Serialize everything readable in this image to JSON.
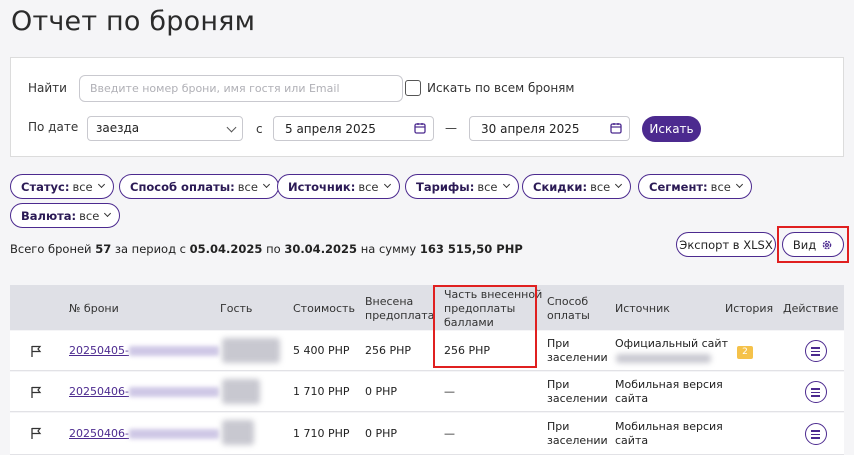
{
  "page": {
    "title": "Отчет по броням"
  },
  "filters": {
    "find_label": "Найти",
    "search_placeholder": "Введите номер брони, имя гостя или Email",
    "search_all_label": "Искать по всем броням",
    "by_date_label": "По дате",
    "date_type_value": "заезда",
    "from_prefix": "с",
    "date_from": "5 апреля 2025",
    "date_dash": "—",
    "date_to": "30 апреля 2025",
    "search_button": "Искать"
  },
  "chips": [
    {
      "name": "Статус:",
      "value": "все"
    },
    {
      "name": "Способ оплаты:",
      "value": "все"
    },
    {
      "name": "Источник:",
      "value": "все"
    },
    {
      "name": "Тарифы:",
      "value": "все"
    },
    {
      "name": "Скидки:",
      "value": "все"
    },
    {
      "name": "Сегмент:",
      "value": "все"
    },
    {
      "name": "Валюта:",
      "value": "все"
    }
  ],
  "summary": {
    "t1": "Всего броней",
    "count": "57",
    "t2": "за период с",
    "from": "05.04.2025",
    "t3": "по",
    "to": "30.04.2025",
    "t4": "на сумму",
    "sum": "163 515,50 PHP"
  },
  "actions": {
    "export_label": "Экспорт в XLSX",
    "view_label": "Вид"
  },
  "table": {
    "headers": {
      "number": "№ брони",
      "guest": "Гость",
      "cost": "Стоимость",
      "prepaid_l1": "Внесена",
      "prepaid_l2": "предоплата",
      "points_l1": "Часть внесенной",
      "points_l2": "предоплаты",
      "points_l3": "баллами",
      "payment_l1": "Способ",
      "payment_l2": "оплаты",
      "source": "Источник",
      "history": "История",
      "action": "Действие"
    },
    "rows": [
      {
        "number": "20250405-",
        "cost": "5 400 PHP",
        "prepaid": "256 PHP",
        "points": "256 PHP",
        "payment_l1": "При",
        "payment_l2": "заселении",
        "source_l1": "Официальный сайт",
        "source_l2": "",
        "history": "2"
      },
      {
        "number": "20250406-",
        "cost": "1 710 PHP",
        "prepaid": "0 PHP",
        "points": "—",
        "payment_l1": "При",
        "payment_l2": "заселении",
        "source_l1": "Мобильная версия",
        "source_l2": "сайта",
        "history": ""
      },
      {
        "number": "20250406-",
        "cost": "1 710 PHP",
        "prepaid": "0 PHP",
        "points": "—",
        "payment_l1": "При",
        "payment_l2": "заселении",
        "source_l1": "Мобильная версия",
        "source_l2": "сайта",
        "history": ""
      }
    ]
  },
  "colors": {
    "accent": "#4c2a8f",
    "highlight": "#e02020",
    "badge": "#f5c24a",
    "header_bg": "#dfe0e6"
  }
}
